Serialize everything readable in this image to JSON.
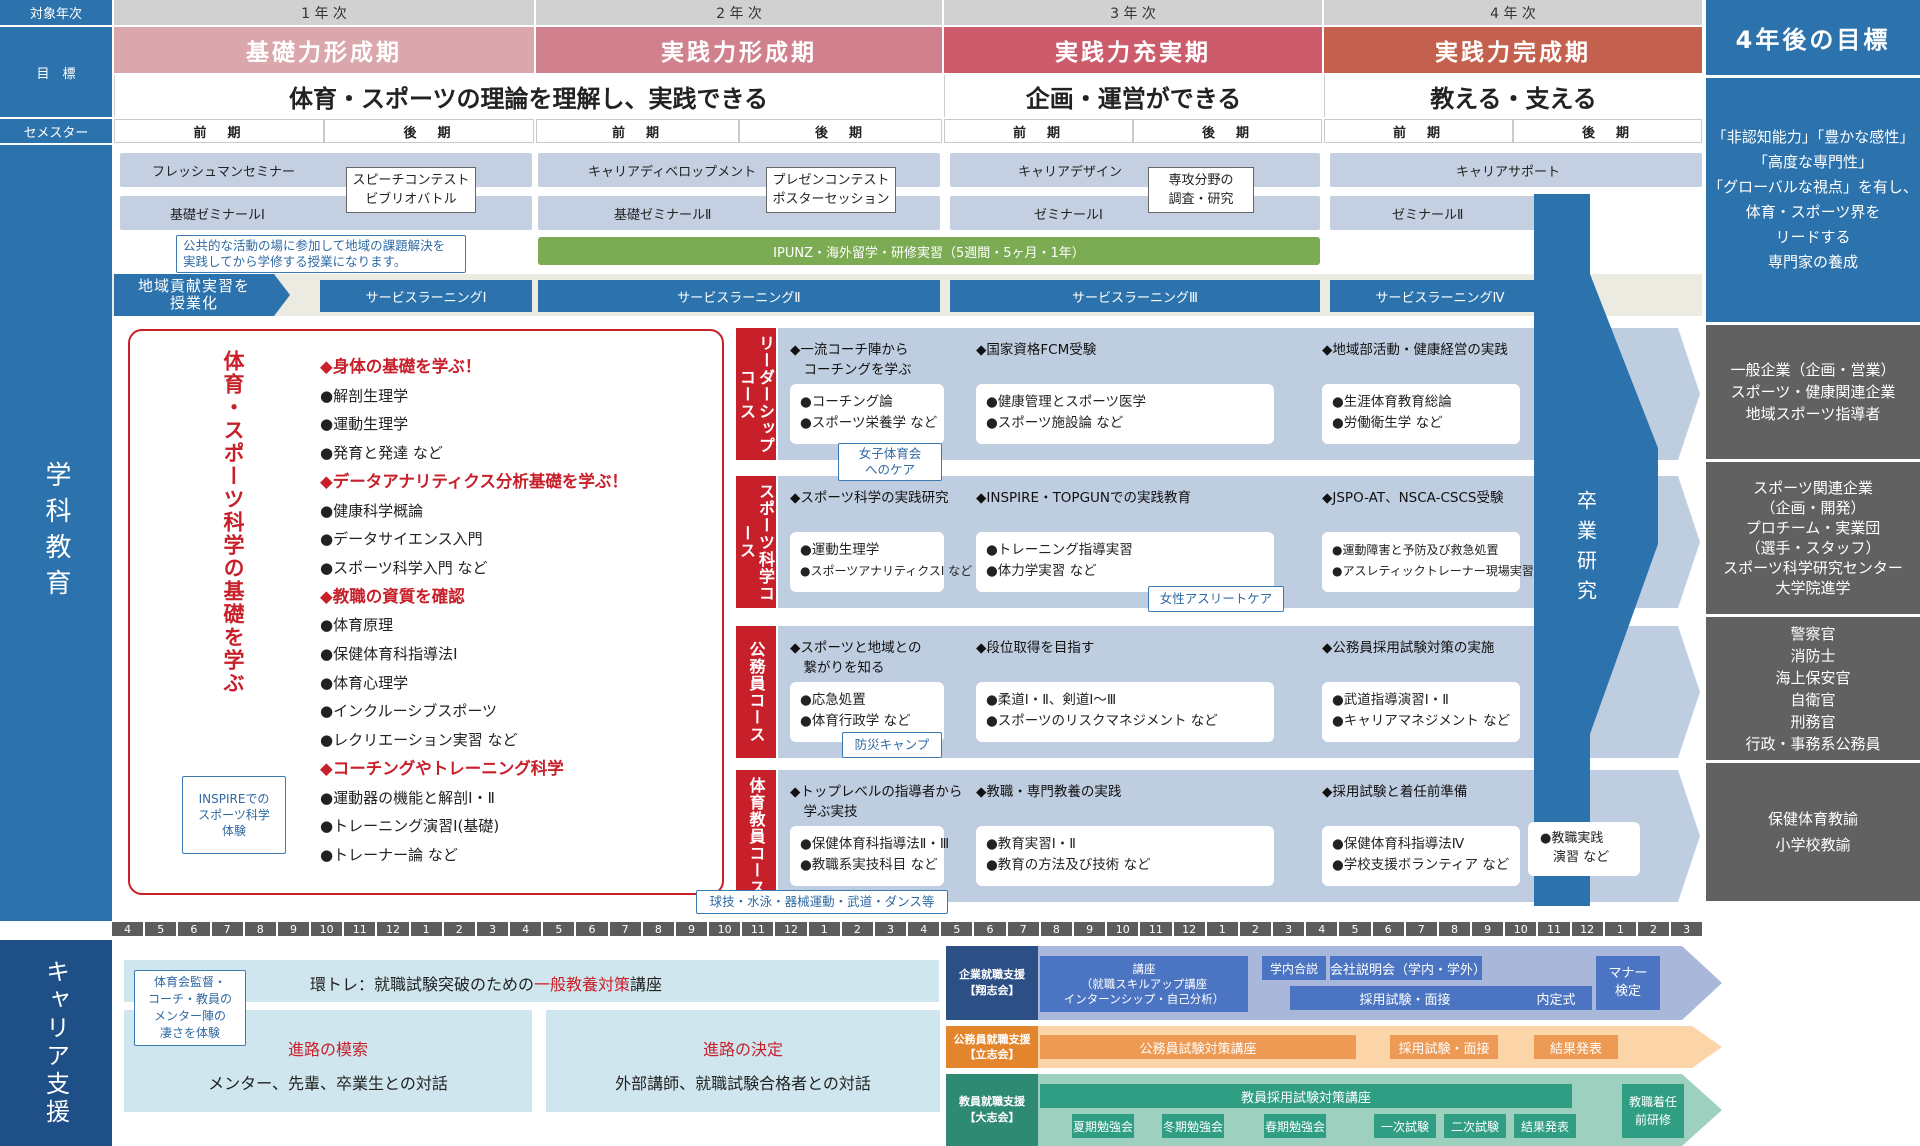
{
  "header": {
    "target_year_label": "対象年次",
    "goal_label": "目　標",
    "semester_label": "セメスター",
    "years": [
      "1 年 次",
      "2 年 次",
      "3 年 次",
      "4 年 次"
    ],
    "phases": [
      "基礎力形成期",
      "実践力形成期",
      "実践力充実期",
      "実践力完成期"
    ],
    "goals": [
      "体育・スポーツの理論を理解し、実践できる",
      "企画・運営ができる",
      "教える・支える"
    ],
    "semesters": [
      "前　期",
      "後　期",
      "前　期",
      "後　期",
      "前　期",
      "後　期",
      "前　期",
      "後　期"
    ],
    "after_title": "4年後の目標"
  },
  "colors": {
    "navy": "#2c73ad",
    "red": "#c8202b",
    "phase1": "#d9a7ac",
    "phase2": "#d0818d",
    "phase3": "#cc5c6c",
    "phase4": "#c4614e",
    "gray": "#616161",
    "green": "#7bab53"
  },
  "left": {
    "academic": "学科教育",
    "career": "キャリア支援"
  },
  "row1": {
    "fresh": "フレッシュマンセミナー",
    "speech": [
      "スピーチコンテスト",
      "ビブリオバトル"
    ],
    "career_dev": "キャリアディベロップメント",
    "present": [
      "プレゼンコンテスト",
      "ポスターセッション"
    ],
    "career_design": "キャリアデザイン",
    "research": [
      "専攻分野の",
      "調査・研究"
    ],
    "career_support": "キャリアサポート",
    "kiso1": "基礎ゼミナールⅠ",
    "kiso2": "基礎ゼミナールⅡ",
    "semi1": "ゼミナールⅠ",
    "semi2": "ゼミナールⅡ",
    "public_note": [
      "公共的な活動の場に参加して地域の課題解決を",
      "実践してから学修する授業になります。"
    ],
    "ipunz": "IPUNZ・海外留学・研修実習（5週間・5ヶ月・1年）",
    "community": [
      "地域貢献実習を",
      "授業化"
    ],
    "service": [
      "サービスラーニングⅠ",
      "サービスラーニングⅡ",
      "サービスラーニングⅢ",
      "サービスラーニングⅣ"
    ]
  },
  "goals_after": {
    "top": [
      "「非認知能力」「豊かな感性」",
      "「高度な専門性」",
      "「グローバルな視点」を有し、",
      "体育・スポーツ界を",
      "リードする",
      "専門家の養成"
    ],
    "c1": [
      "一般企業（企画・営業）",
      "スポーツ・健康関連企業",
      "地域スポーツ指導者"
    ],
    "c2": [
      "スポーツ関連企業",
      "（企画・開発）",
      "プロチーム・実業団",
      "（選手・スタッフ）",
      "スポーツ科学研究センター",
      "大学院進学"
    ],
    "c3": [
      "警察官",
      "消防士",
      "海上保安官",
      "自衛官",
      "刑務官",
      "行政・事務系公務員"
    ],
    "c4": [
      "保健体育教諭",
      "小学校教諭"
    ]
  },
  "foundation": {
    "title": "体育・スポーツ科学の基礎を学ぶ",
    "items": [
      {
        "h": "◆身体の基礎を学ぶ！"
      },
      {
        "t": "●解剖生理学"
      },
      {
        "t": "●運動生理学"
      },
      {
        "t": "●発育と発達 など"
      },
      {
        "h": "◆データアナリティクス分析基礎を学ぶ！"
      },
      {
        "t": "●健康科学概論"
      },
      {
        "t": "●データサイエンス入門"
      },
      {
        "t": "●スポーツ科学入門 など"
      },
      {
        "h": "◆教職の資質を確認"
      },
      {
        "t": "●体育原理"
      },
      {
        "t": "●保健体育科指導法Ⅰ"
      },
      {
        "t": "●体育心理学"
      },
      {
        "t": "●インクルーシブスポーツ"
      },
      {
        "t": "●レクリエーション実習 など"
      },
      {
        "h": "◆コーチングやトレーニング科学"
      },
      {
        "t": "●運動器の機能と解剖Ⅰ・Ⅱ"
      },
      {
        "t": "●トレーニング演習Ⅰ(基礎)"
      },
      {
        "t": "●トレーナー論 など"
      }
    ],
    "inspire_note": [
      "INSPIREでの",
      "スポーツ科学",
      "体験"
    ]
  },
  "courses": [
    {
      "tag": "リーダーシップコース",
      "tasks": [
        [
          "◆一流コーチ陣から",
          "　コーチングを学ぶ"
        ],
        [
          "◆国家資格FCM受験"
        ],
        [
          "◆地域部活動・健康経営の実践"
        ]
      ],
      "boxes": [
        [
          "●コーチング論",
          "●スポーツ栄養学 など"
        ],
        [
          "●健康管理とスポーツ医学",
          "●スポーツ施設論 など"
        ],
        [
          "●生涯体育教育総論",
          "●労働衛生学 など"
        ]
      ],
      "note": [
        "女子体育会",
        "へのケア"
      ]
    },
    {
      "tag": "スポーツ科学コース",
      "tasks": [
        [
          "◆スポーツ科学の実践研究"
        ],
        [
          "◆INSPIRE・TOPGUNでの実践教育"
        ],
        [
          "◆JSPO-AT、NSCA-CSCS受験"
        ]
      ],
      "boxes": [
        [
          "●運動生理学",
          "●スポーツアナリティクスⅠ など"
        ],
        [
          "●トレーニング指導実習",
          "●体力学実習 など"
        ],
        [
          "●運動障害と予防及び救急処置",
          "●アスレティックトレーナー現場実習 など"
        ]
      ],
      "note": [
        "女性アスリートケア"
      ]
    },
    {
      "tag": "公務員コース",
      "tasks": [
        [
          "◆スポーツと地域との",
          "　繋がりを知る"
        ],
        [
          "◆段位取得を目指す"
        ],
        [
          "◆公務員採用試験対策の実施"
        ]
      ],
      "boxes": [
        [
          "●応急処置",
          "●体育行政学 など"
        ],
        [
          "●柔道Ⅰ・Ⅱ、剣道Ⅰ〜Ⅲ",
          "●スポーツのリスクマネジメント など"
        ],
        [
          "●武道指導演習Ⅰ・Ⅱ",
          "●キャリアマネジメント など"
        ]
      ],
      "note": [
        "防災キャンプ"
      ]
    },
    {
      "tag": "体育教員コース",
      "tasks": [
        [
          "◆トップレベルの指導者から",
          "　学ぶ実技"
        ],
        [
          "◆教職・専門教養の実践"
        ],
        [
          "◆採用試験と着任前準備"
        ]
      ],
      "boxes": [
        [
          "●保健体育科指導法Ⅱ・Ⅲ",
          "●教職系実技科目 など"
        ],
        [
          "●教育実習Ⅰ・Ⅱ",
          "●教育の方法及び技術 など"
        ],
        [
          "●保健体育科指導法Ⅳ",
          "●学校支援ボランティア など"
        ]
      ],
      "note": [
        "球技・水泳・器械運動・武道・ダンス等"
      ],
      "extra": [
        "●教職実践",
        "　演習 など"
      ]
    }
  ],
  "graduation": "卒業研究",
  "months": [
    "4",
    "5",
    "6",
    "7",
    "8",
    "9",
    "10",
    "11",
    "12",
    "1",
    "2",
    "3",
    "4",
    "5",
    "6",
    "7",
    "8",
    "9",
    "10",
    "11",
    "12",
    "1",
    "2",
    "3",
    "4",
    "5",
    "6",
    "7",
    "8",
    "9",
    "10",
    "11",
    "12",
    "1",
    "2",
    "3",
    "4",
    "5",
    "6",
    "7",
    "8",
    "9",
    "10",
    "11",
    "12",
    "1",
    "2",
    "3"
  ],
  "career": {
    "coach_note": [
      "体育会監督・",
      "コーチ・教員の",
      "メンター陣の",
      "凄さを体験"
    ],
    "kantore_a": "環トレ：就職試験突破のための",
    "kantore_b": "一般教養対策",
    "kantore_c": "講座",
    "path1_title": "進路の模索",
    "path1_body": "メンター、先輩、卒業生との対話",
    "path2_title": "進路の決定",
    "path2_body": "外部講師、就職試験合格者との対話",
    "corp_label": [
      "企業就職支援",
      "【翔志会】"
    ],
    "corp_lecture": [
      "講座",
      "（就職スキルアップ講座",
      "インターンシップ・自己分析）"
    ],
    "corp_items": [
      "学内合説",
      "会社説明会（学内・学外）",
      "採用試験・面接",
      "内定式"
    ],
    "manner": [
      "マナー",
      "検定"
    ],
    "pub_label": [
      "公務員就職支援",
      "【立志会】"
    ],
    "pub_items": [
      "公務員試験対策講座",
      "採用試験・面接",
      "結果発表"
    ],
    "tea_label": [
      "教員就職支援",
      "【大志会】"
    ],
    "tea_main": "教員採用試験対策講座",
    "tea_items": [
      "夏期勉強会",
      "冬期勉強会",
      "春期勉強会",
      "一次試験",
      "二次試験",
      "結果発表"
    ],
    "tea_last": [
      "教職着任",
      "前研修"
    ]
  }
}
